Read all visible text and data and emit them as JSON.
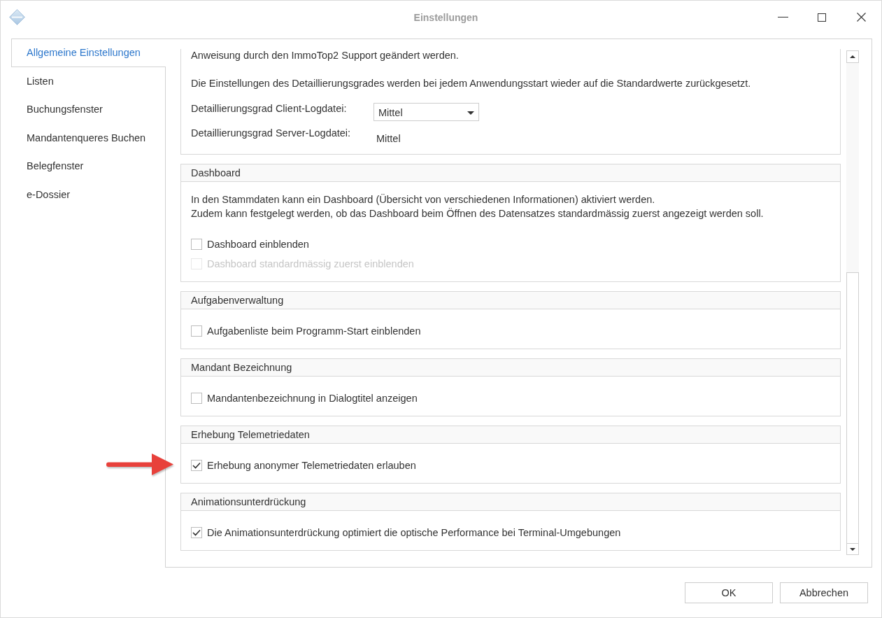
{
  "window": {
    "title": "Einstellungen"
  },
  "sidebar": {
    "items": [
      {
        "label": "Allgemeine Einstellungen",
        "selected": true
      },
      {
        "label": "Listen",
        "selected": false
      },
      {
        "label": "Buchungsfenster",
        "selected": false
      },
      {
        "label": "Mandantenqueres Buchen",
        "selected": false
      },
      {
        "label": "Belegfenster",
        "selected": false
      },
      {
        "label": "e-Dossier",
        "selected": false
      }
    ]
  },
  "log_section": {
    "paragraphs": [
      "Anweisung durch den ImmoTop2 Support geändert werden.",
      "Die Einstellungen des Detaillierungsgrades werden bei jedem Anwendungsstart wieder auf die Standardwerte zurückgesetzt."
    ],
    "fields": [
      {
        "kind": "dropdown",
        "label": "Detaillierungsgrad Client-Logdatei:",
        "value": "Mittel"
      },
      {
        "kind": "readonly",
        "label": "Detaillierungsgrad Server-Logdatei:",
        "value": "Mittel"
      }
    ]
  },
  "groups": [
    {
      "title": "Dashboard",
      "paragraphs": [
        "In den Stammdaten kann ein Dashboard (Übersicht von verschiedenen Informationen) aktiviert werden.",
        "Zudem kann festgelegt werden, ob das Dashboard beim Öffnen des Datensatzes standardmässig zuerst angezeigt werden soll."
      ],
      "checkboxes": [
        {
          "label": "Dashboard einblenden",
          "checked": false,
          "disabled": false
        },
        {
          "label": "Dashboard standardmässig zuerst einblenden",
          "checked": false,
          "disabled": true
        }
      ]
    },
    {
      "title": "Aufgabenverwaltung",
      "checkboxes": [
        {
          "label": "Aufgabenliste beim Programm-Start einblenden",
          "checked": false,
          "disabled": false
        }
      ]
    },
    {
      "title": "Mandant Bezeichnung",
      "checkboxes": [
        {
          "label": "Mandantenbezeichnung in Dialogtitel anzeigen",
          "checked": false,
          "disabled": false
        }
      ]
    },
    {
      "title": "Erhebung Telemetriedaten",
      "checkboxes": [
        {
          "label": "Erhebung anonymer Telemetriedaten erlauben",
          "checked": true,
          "disabled": false
        }
      ]
    },
    {
      "title": "Animationsunterdrückung",
      "checkboxes": [
        {
          "label": "Die Animationsunterdrückung optimiert die optische Performance bei Terminal-Umgebungen",
          "checked": true,
          "disabled": false
        }
      ]
    }
  ],
  "buttons": [
    {
      "label": "OK"
    },
    {
      "label": "Abbrechen"
    }
  ]
}
